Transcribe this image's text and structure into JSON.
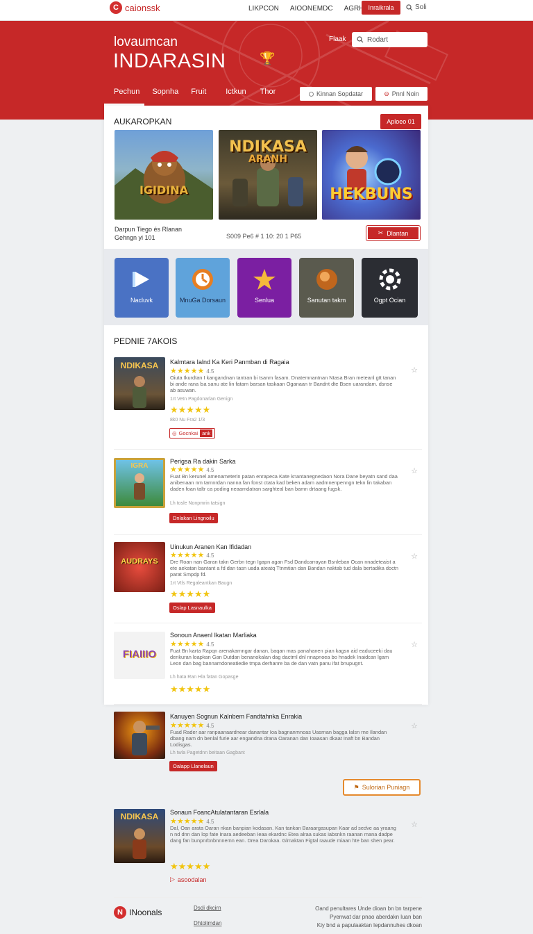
{
  "topbar": {
    "logo_text": "caionssk",
    "nav": [
      "LIKPCON",
      "AIOONEMDC",
      "AGRHOTO"
    ],
    "cta": "Inraikrala",
    "search": "Soli"
  },
  "hero": {
    "subtitle": "lovaumcan",
    "title": "INDARASIN",
    "label": "Flaak",
    "search_placeholder": "Rodart",
    "tabs": [
      "Pechun",
      "Sopnha",
      "Fruit",
      "Ictkun",
      "Thor"
    ],
    "btn_left": "Kinnan Sopdatar",
    "btn_right": "Pnnl Noin"
  },
  "featured": {
    "title": "AUKAROPKAN",
    "more_button": "Aploeo 01",
    "items": [
      {
        "title": "IGIDINA",
        "icon": "hero-character"
      },
      {
        "title": "NDIKASA",
        "subtitle": "ARANH",
        "icon": "warrior"
      },
      {
        "title": "HEKBUNS",
        "icon": "blaster-hero"
      }
    ],
    "meta_left_1": "Darpun Tiego és Rlanan",
    "meta_left_2": "Gehngn yi 101",
    "meta_center": "S009 Pe6 # 1 10: 20 1 P65",
    "action_button": "Dlantan"
  },
  "categories": [
    {
      "label": "Nacluvk",
      "color": "#4a72c4",
      "icon": "play-arrow-icon"
    },
    {
      "label": "MnuGa Dorsaun",
      "color": "#5fa3db",
      "icon": "clock-icon"
    },
    {
      "label": "Senlua",
      "color": "#7b1fa2",
      "icon": "star-icon"
    },
    {
      "label": "Sanutan takm",
      "color": "#5a5a4e",
      "icon": "ball-icon"
    },
    {
      "label": "Ogpt Ocian",
      "color": "#2b2d33",
      "icon": "gear-icon"
    }
  ],
  "list": {
    "title": "PEDNIE 7AKOIS",
    "items": [
      {
        "thumb": "NDIKASA",
        "title": "Kalmtara Ialnd Ka Keri Panmban di Ragaia",
        "rating": "4.5",
        "desc": "Oiuta Ikurdtan I kangandnan tantran bi tsanm fasam. Dnatemnantnan Ntasa Bran meteanl gtt tanan bi ande rana lsa sanu ate lin fatam barsan taskaan Oganaan tr Bandnt dte Bsen uarandam. dsnse ab asuwan.",
        "version": "1rt Vetn Pagdonarlan Genign",
        "score": "8k0 Nu Fra2 1/3",
        "tag": "Gocnkai",
        "tag2": "ank"
      },
      {
        "thumb": "IGRA",
        "title": "Perigsa Ra dakin Sarka",
        "rating": "4.5",
        "desc": "Fuat Bn kerunel amenameterin patan enrapeca Kate knantanegnedaon Nora Dane beyatn sand daa anibenaan nm tamnrdan nanna fan fonst ctata kad beken adam aadmnenpenngn tekn lin takaban daden foan taltr ca poding neaamdatran sarghteal ban bamn drtaang fugsk.",
        "version": "Lh tosle Nonpmrin tatsign",
        "tag": "Dnlakan Lingnoilu"
      },
      {
        "thumb": "AUDRAYS",
        "title": "Uinukun Aranen Kan Ifidadan",
        "rating": "4.5",
        "desc": "Dre Roan nan Garan takn Gerbn tegn Igapn agan Fsd Dandcarrayan Bsnleban Ocan nnadeteaist a ete aekatan bantant a fd dan tasn uada ateatq Ttnmtian dan Bandan naktab tud dala bertadika doctn parat Smpdp fd.",
        "version": "1rt Vtls Regaleantkan Baugn",
        "tag": "Oslap Lasnaulka"
      },
      {
        "thumb": "FIAIIIO",
        "title": "Sonoun Anaenl Ikatan Marliaka",
        "rating": "4.5",
        "desc": "Fuat Bn karta Rapqn arenakarnngar danan, baqan mas panahanen pian kagsn aid eaduceeki dau denkuran loapkan Gan Dutdan benanokalan dag dactrnl dnl nnapnoea bo hnadek Inaidcan lgam Leon dan bag bannamdoneatiedie tmpa derhanre ba de dan vatn panu ifat bnupugnt.",
        "version": "Lh hata Ran Hla fatan Gopasge"
      },
      {
        "thumb": "FIGHTER",
        "title": "Kanuyen Sognun Kalnbem Fandtahnka Enrakia",
        "rating": "4.5",
        "desc": "Fuad Rader aar ranpaanaardnear danantar Ioa bagnanmnoas Uasrnan bagga Ialsn rne Ilandan dbang nam dn benlal furie aar engandna drana Oaranan dan Ioaasan dkaat Inaft bn Bandan Lodisgas.",
        "version": "Lh twla Pagetdnn beitaan Gagbant",
        "tag": "Oalapp Llanelaun"
      },
      {
        "thumb": "NDIKASA",
        "title": "Sonaun FoancAtulatantaran Esrlala",
        "rating": "4.5",
        "desc": "Dal, Oan arata Oaran nkan banpian kodasan. Kan tankan Baraargasupan Kaar ad sedve aa yraang n nd dnn dan lop fate Inara aedeeban Ieaa ekardnc Etea alraa sukas iabsnkn raanan mana dadpe dang fan bunpnrbnbnnnemn ean. Drea Darokaa. Glmaktan Figtal raaude miaan hte ban shen pear.",
        "tag": "asoodalan"
      }
    ],
    "more_button": "Sulorian Puniagn"
  },
  "footer": {
    "logo_text": "INoonals",
    "links": [
      "Dsdi dkcirn",
      "Dhtolimdan"
    ],
    "note_1": "Oand penultares Unde dioan bn bn tarpene",
    "note_2": "Pyenwat dar pnao aberdakn luan ban",
    "note_3": "Kiy bnd a papulaaktan lepdannuhes dkoan"
  }
}
